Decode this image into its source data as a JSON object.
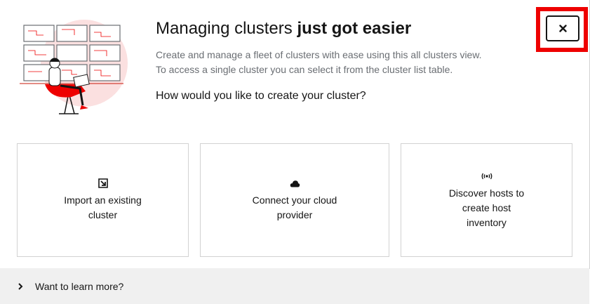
{
  "hero": {
    "title_regular": "Managing clusters ",
    "title_bold": "just got easier",
    "description_line1": "Create and manage a fleet of clusters with ease using this all clusters view.",
    "description_line2": "To access a single cluster you can select it from the cluster list table.",
    "question": "How would you like to create your cluster?",
    "illustration": "person-at-monitor-wall-illustration"
  },
  "close_button": {
    "icon": "close-icon",
    "highlight_color": "#ee0000"
  },
  "cards": [
    {
      "icon": "import-arrow-icon",
      "label": "Import an existing cluster"
    },
    {
      "icon": "cloud-icon",
      "label": "Connect your cloud provider"
    },
    {
      "icon": "broadcast-signal-icon",
      "label": "Discover hosts to create host inventory"
    }
  ],
  "learn_more": {
    "icon": "chevron-right-icon",
    "label": "Want to learn more?"
  },
  "colors": {
    "accent": "#ee0000",
    "text": "#151515",
    "muted": "#6a6e73",
    "border": "#d2d2d2",
    "footer_bg": "#f0f0f0"
  }
}
